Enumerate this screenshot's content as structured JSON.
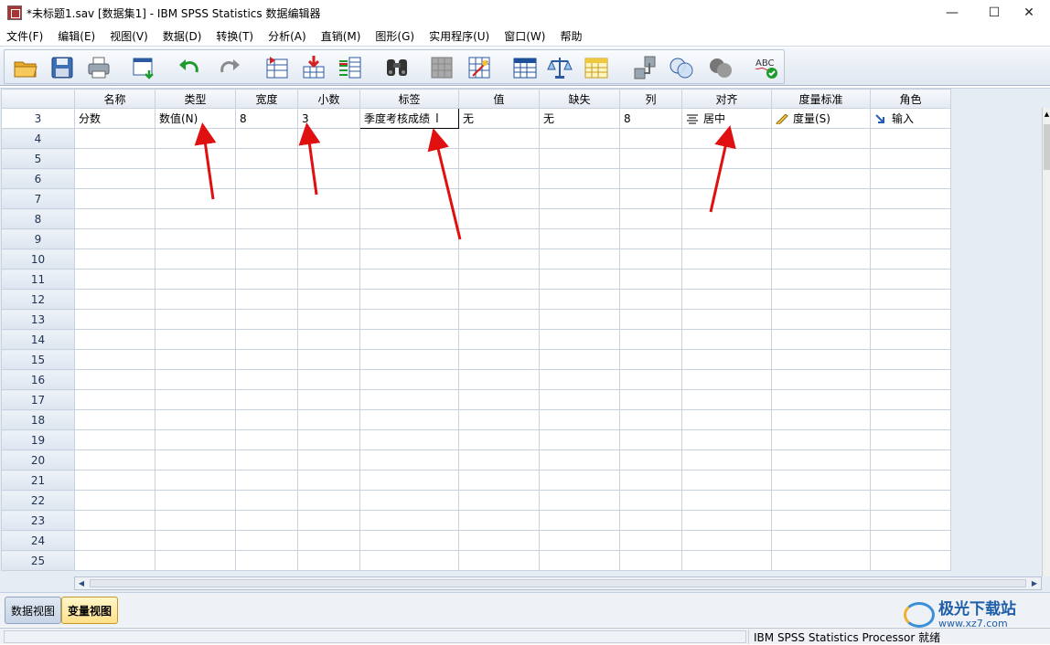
{
  "window": {
    "title": "*未标题1.sav [数据集1] - IBM SPSS Statistics 数据编辑器",
    "minimize": "—",
    "maximize": "☐",
    "close": "✕"
  },
  "menu": [
    "文件(F)",
    "编辑(E)",
    "视图(V)",
    "数据(D)",
    "转换(T)",
    "分析(A)",
    "直销(M)",
    "图形(G)",
    "实用程序(U)",
    "窗口(W)",
    "帮助"
  ],
  "toolbar": {
    "icons": [
      "open-folder-icon",
      "save-icon",
      "print-icon",
      "recall-dialog-icon",
      "undo-icon",
      "redo-icon",
      "goto-case-icon",
      "goto-variable-icon",
      "variables-icon",
      "find-icon",
      "insert-cases-icon",
      "insert-variable-icon",
      "split-file-icon",
      "weight-cases-icon",
      "select-cases-icon",
      "value-labels-icon",
      "use-sets-icon",
      "show-all-icon",
      "spell-check-icon"
    ]
  },
  "grid": {
    "columns": [
      "名称",
      "类型",
      "宽度",
      "小数",
      "标签",
      "值",
      "缺失",
      "列",
      "对齐",
      "度量标准",
      "角色"
    ],
    "first_row": {
      "row_number": "3",
      "name": "分数",
      "type": "数值(N)",
      "width": "8",
      "decimals": "3",
      "label": "季度考核成绩",
      "values": "无",
      "missing": "无",
      "columns": "8",
      "align": "居中",
      "measure": "度量(S)",
      "role": "输入"
    },
    "row_numbers": [
      "4",
      "5",
      "6",
      "7",
      "8",
      "9",
      "10",
      "11",
      "12",
      "13",
      "14",
      "15",
      "16",
      "17",
      "18",
      "19",
      "20",
      "21",
      "22",
      "23",
      "24",
      "25"
    ]
  },
  "tabs": {
    "data_view": "数据视图",
    "variable_view": "变量视图"
  },
  "status": {
    "processor": "IBM SPSS Statistics Processor 就绪"
  },
  "watermark": {
    "name": "极光下载站",
    "url": "www.xz7.com"
  },
  "colors": {
    "accent_arrow": "#e01010",
    "active_tab": "#ffe08a",
    "header_bg": "#e4eaf2"
  }
}
